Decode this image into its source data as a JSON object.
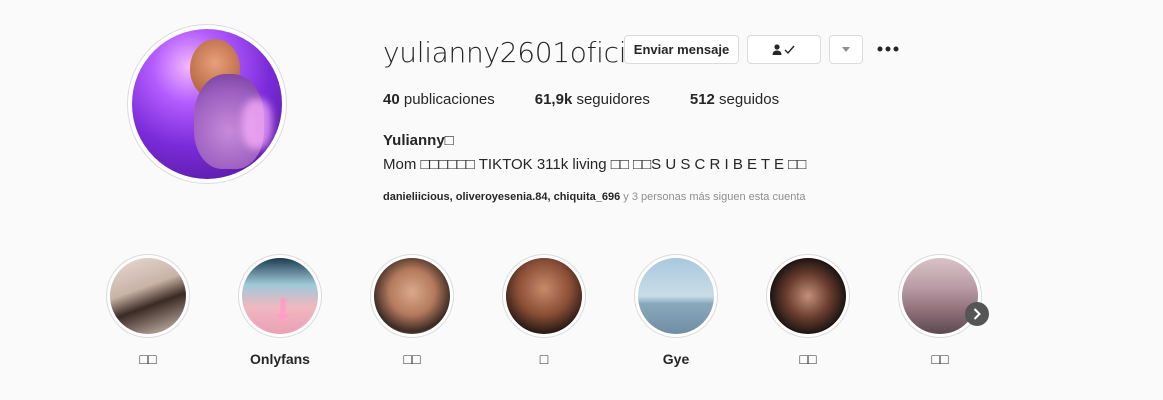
{
  "profile": {
    "username": "yulianny2601oficial",
    "full_name": "Yulianny□",
    "bio": "Mom □□□□□□ TIKTOK 311k living □□ □□S U S C R I B E T E □□",
    "followed_by_users": "danieliicious, oliveroyesenia.84, chiquita_696",
    "followed_by_suffix": " y 3 personas más siguen esta cuenta"
  },
  "actions": {
    "message_label": "Enviar mensaje",
    "follow_icon": "person-check-icon",
    "dropdown_icon": "caret-down-icon",
    "more_icon": "ellipsis-icon"
  },
  "stats": {
    "posts_count": "40",
    "posts_label": " publicaciones",
    "followers_count": "61,9k",
    "followers_label": " seguidores",
    "following_count": "512",
    "following_label": " seguidos"
  },
  "highlights": [
    {
      "label": "□□"
    },
    {
      "label": "Onlyfans"
    },
    {
      "label": "□□"
    },
    {
      "label": "□"
    },
    {
      "label": "Gye"
    },
    {
      "label": "□□"
    },
    {
      "label": "□□"
    }
  ],
  "colors": {
    "background": "#fafafa",
    "text": "#262626",
    "muted": "#8e8e8e",
    "border": "#dbdbdb"
  }
}
